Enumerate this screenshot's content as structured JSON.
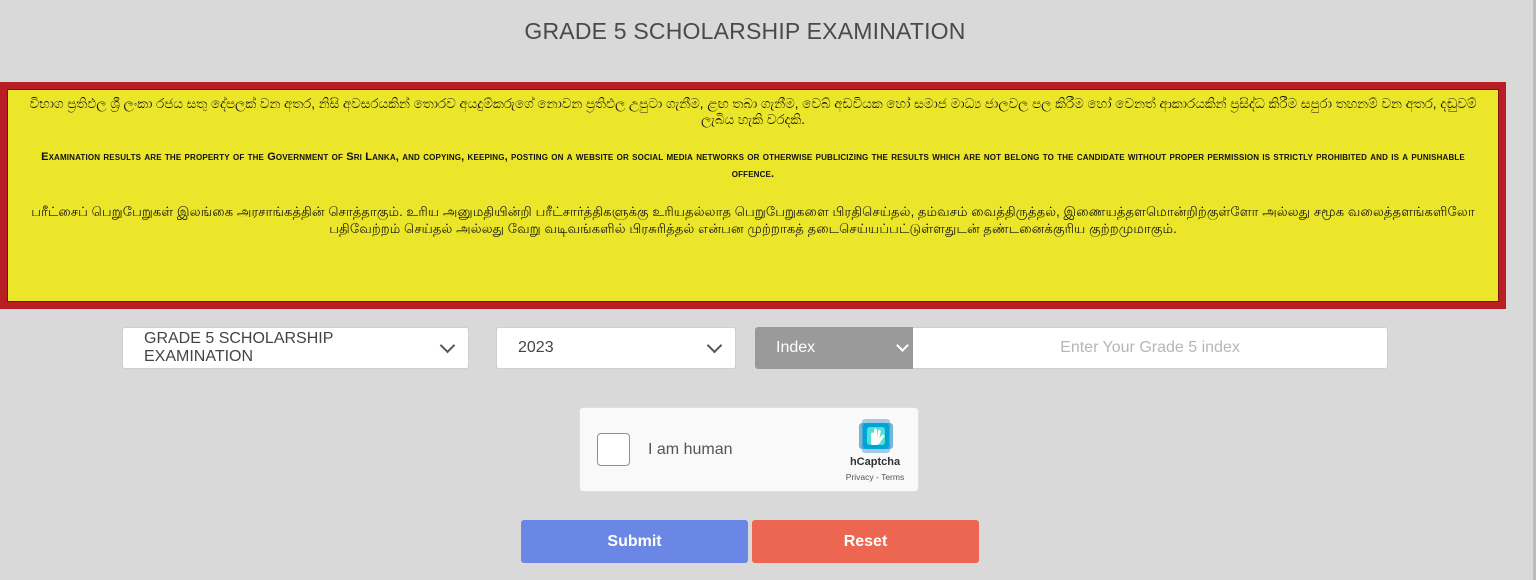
{
  "page": {
    "title": "GRADE 5 SCHOLARSHIP EXAMINATION"
  },
  "notice": {
    "sinhala": "විභාග ප්‍රතිඵල ශ්‍රී ලංකා රජය සතු දේපලක් වන අතර, නිසි අවසරයකින් තොරව අයදුම්කරුගේ නොවන ප්‍රතිඵල උපුටා ගැනීම, ළඟ තබා ගැනීම, වෙබ් අඩවියක හෝ සමාජ මාධ්‍ය ජාලවල පල කිරීම හෝ වෙනත් ආකාරයකින් ප්‍රසිද්ධ කිරීම සපුරා තහනම් වන අතර, දඬුවම් ලැබිය හැකි වරදකි.",
    "english": "Examination results are the property of the Government of Sri Lanka, and copying, keeping, posting on a website or social media networks or otherwise publicizing the results which are not belong to the candidate without proper permission is strictly prohibited and is a punishable offence.",
    "tamil": "பரீட்சைப் பெறுபேறுகள் இலங்கை அரசாங்கத்தின் சொத்தாகும். உரிய அனுமதியின்றி பரீட்சார்த்திகளுக்கு உரியதல்லாத பெறுபேறுகளை பிரதிசெய்தல், தம்வசம் வைத்திருத்தல், இணையத்தளமொன்றிற்குள்ளோ அல்லது சமூக வலைத்தளங்களிலோ பதிவேற்றம் செய்தல் அல்லது வேறு வடிவங்களில் பிரசுரித்தல் என்பன முற்றாகத் தடைசெய்யப்பட்டுள்ளதுடன் தண்டனைக்குரிய குற்றமுமாகும்."
  },
  "form": {
    "exam_select": {
      "value": "GRADE 5 SCHOLARSHIP EXAMINATION"
    },
    "year_select": {
      "value": "2023"
    },
    "index_type_select": {
      "value": "Index"
    },
    "index_input": {
      "placeholder": "Enter Your Grade 5 index"
    }
  },
  "captcha": {
    "label": "I am human",
    "brand": "hCaptcha",
    "links": "Privacy - Terms"
  },
  "buttons": {
    "submit_label": "Submit",
    "reset_label": "Reset"
  },
  "colors": {
    "notice_background": "#ece62a",
    "notice_border": "#b71f24",
    "submit": "#6b87e5",
    "reset": "#ec6651"
  }
}
